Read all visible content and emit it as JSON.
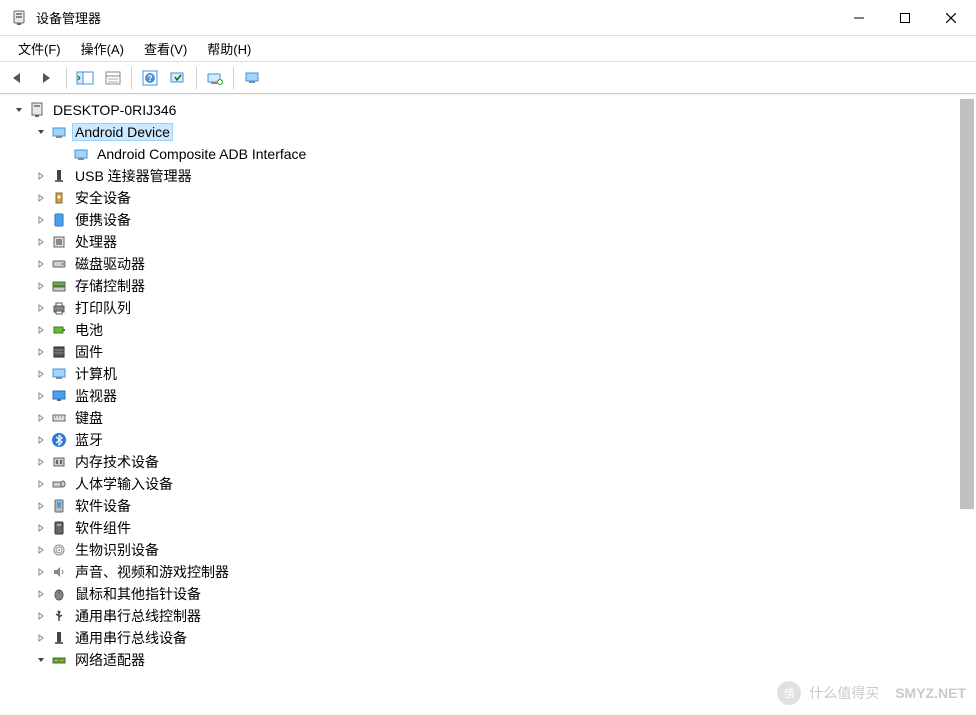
{
  "window": {
    "title": "设备管理器"
  },
  "menu": {
    "file": "文件(F)",
    "action": "操作(A)",
    "view": "查看(V)",
    "help": "帮助(H)"
  },
  "tree": {
    "root": "DESKTOP-0RIJ346",
    "android_device": "Android Device",
    "android_adb": "Android Composite ADB Interface",
    "usb_connector": "USB 连接器管理器",
    "security": "安全设备",
    "portable": "便携设备",
    "processor": "处理器",
    "disk": "磁盘驱动器",
    "storage_ctrl": "存储控制器",
    "print_queue": "打印队列",
    "battery": "电池",
    "firmware": "固件",
    "computer": "计算机",
    "monitor": "监视器",
    "keyboard": "键盘",
    "bluetooth": "蓝牙",
    "memory_tech": "内存技术设备",
    "hid": "人体学输入设备",
    "software_dev": "软件设备",
    "software_comp": "软件组件",
    "biometric": "生物识别设备",
    "sound": "声音、视频和游戏控制器",
    "mouse": "鼠标和其他指针设备",
    "usb_ctrl": "通用串行总线控制器",
    "usb_dev": "通用串行总线设备",
    "network": "网络适配器"
  },
  "watermark": {
    "badge": "值",
    "text1": "什么值得买",
    "text2": "SMYZ.NET"
  }
}
